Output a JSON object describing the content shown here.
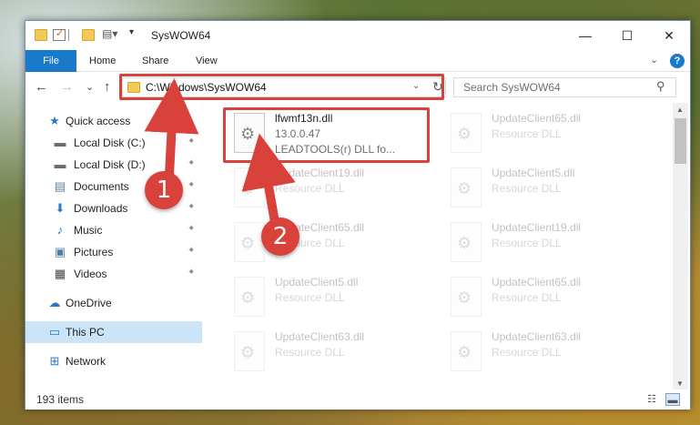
{
  "window": {
    "title": "SysWOW64",
    "controls": {
      "minimize": "—",
      "maximize": "☐",
      "close": "✕"
    }
  },
  "ribbon": {
    "tabs": [
      "File",
      "Home",
      "Share",
      "View"
    ],
    "help_glyph": "?",
    "collapse_glyph": "⌄"
  },
  "nav": {
    "back_glyph": "←",
    "forward_glyph": "→",
    "recent_glyph": "⌄",
    "up_glyph": "↑",
    "address": "C:\\Windows\\SysWOW64",
    "dropdown_glyph": "⌄",
    "refresh_glyph": "↻",
    "search_placeholder": "Search SysWOW64",
    "search_glyph": "⚲"
  },
  "sidebar": {
    "items": [
      {
        "label": "Quick access",
        "icon": "★",
        "icon_name": "star-icon",
        "pinned": false
      },
      {
        "label": "Local Disk (C:)",
        "icon": "▬",
        "icon_name": "drive-icon",
        "pinned": true
      },
      {
        "label": "Local Disk (D:)",
        "icon": "▬",
        "icon_name": "drive-icon",
        "pinned": true
      },
      {
        "label": "Documents",
        "icon": "▤",
        "icon_name": "documents-icon",
        "pinned": true
      },
      {
        "label": "Downloads",
        "icon": "⬇",
        "icon_name": "downloads-icon",
        "pinned": true
      },
      {
        "label": "Music",
        "icon": "♪",
        "icon_name": "music-icon",
        "pinned": true
      },
      {
        "label": "Pictures",
        "icon": "▣",
        "icon_name": "pictures-icon",
        "pinned": true
      },
      {
        "label": "Videos",
        "icon": "▦",
        "icon_name": "videos-icon",
        "pinned": true
      },
      {
        "label": "OneDrive",
        "icon": "☁",
        "icon_name": "onedrive-icon",
        "pinned": false
      },
      {
        "label": "This PC",
        "icon": "▭",
        "icon_name": "this-pc-icon",
        "pinned": false
      },
      {
        "label": "Network",
        "icon": "⊞",
        "icon_name": "network-icon",
        "pinned": false
      }
    ],
    "pin_glyph": "📌"
  },
  "files": [
    {
      "name": "lfwmf13n.dll",
      "line2": "13.0.0.47",
      "line3": "LEADTOOLS(r) DLL fo...",
      "highlighted": true
    },
    {
      "name": "UpdateClient65.dll",
      "line2": "Resource DLL"
    },
    {
      "name": "UpdateClient19.dll",
      "line2": "Resource DLL"
    },
    {
      "name": "UpdateClient5.dll",
      "line2": "Resource DLL"
    },
    {
      "name": "UpdateClient65.dll",
      "line2": "Resource DLL"
    },
    {
      "name": "UpdateClient19.dll",
      "line2": "Resource DLL"
    },
    {
      "name": "UpdateClient5.dll",
      "line2": "Resource DLL"
    },
    {
      "name": "UpdateClient65.dll",
      "line2": "Resource DLL"
    },
    {
      "name": "UpdateClient63.dll",
      "line2": "Resource DLL"
    },
    {
      "name": "UpdateClient63.dll",
      "line2": "Resource DLL"
    }
  ],
  "status": {
    "item_count": "193 items"
  },
  "annotations": {
    "badge1": "1",
    "badge2": "2",
    "color": "#d9423a"
  }
}
